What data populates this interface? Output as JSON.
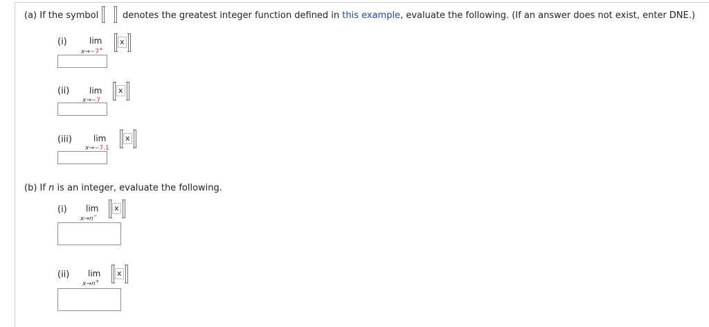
{
  "part_a": {
    "intro_prefix": "(a) If the symbol",
    "intro_mid": "denotes the greatest integer function defined in",
    "link_text": "this example",
    "intro_suffix": ", evaluate the following. (If an answer does not exist, enter DNE.)",
    "items": [
      {
        "label": "(i)",
        "lim": "lim",
        "sub_var": "x",
        "arrow": "→",
        "sub_val": "−7",
        "sup": "+",
        "var": "x",
        "answer": ""
      },
      {
        "label": "(ii)",
        "lim": "lim",
        "sub_var": "x",
        "arrow": "→",
        "sub_val": "−7",
        "sup": "",
        "var": "x",
        "answer": ""
      },
      {
        "label": "(iii)",
        "lim": "lim",
        "sub_var": "x",
        "arrow": "→",
        "sub_val": "−7.1",
        "sup": "",
        "var": "x",
        "answer": ""
      }
    ]
  },
  "part_b": {
    "intro_prefix": "(b) If",
    "intro_var": "n",
    "intro_suffix": "is an integer, evaluate the following.",
    "items": [
      {
        "label": "(i)",
        "lim": "lim",
        "sub_var": "x",
        "arrow": "→",
        "sub_val": "n",
        "sup": "−",
        "var": "x",
        "answer": ""
      },
      {
        "label": "(ii)",
        "lim": "lim",
        "sub_var": "x",
        "arrow": "→",
        "sub_val": "n",
        "sup": "+",
        "var": "x",
        "answer": ""
      }
    ]
  }
}
